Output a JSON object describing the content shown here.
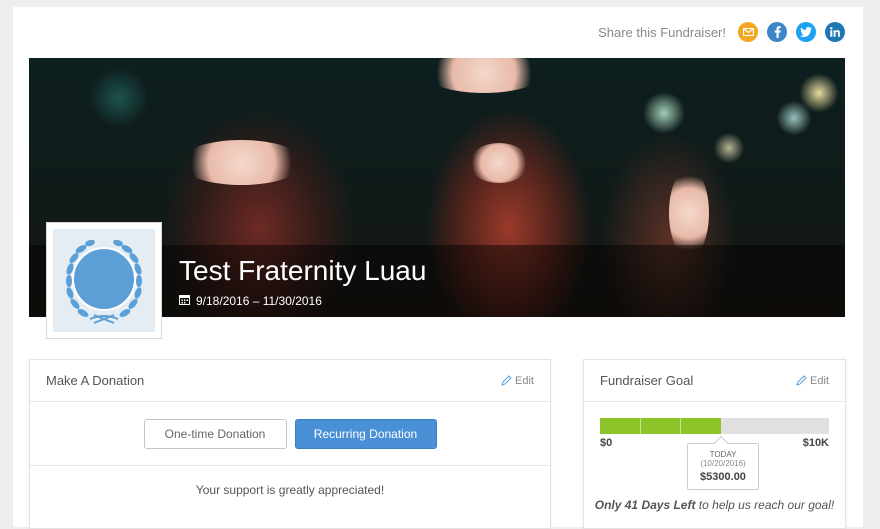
{
  "share": {
    "label": "Share this Fundraiser!",
    "icons": [
      "email-icon",
      "facebook-icon",
      "twitter-icon",
      "linkedin-icon"
    ],
    "colors": {
      "email": "#f5a623",
      "facebook": "#3b86c8",
      "twitter": "#1da1f2",
      "linkedin": "#1f78b4"
    }
  },
  "banner": {
    "title": "Test Fraternity Luau",
    "dates": "9/18/2016 – 11/30/2016"
  },
  "donation": {
    "title": "Make A Donation",
    "edit_label": "Edit",
    "one_time_label": "One-time Donation",
    "recurring_label": "Recurring Donation",
    "support_text": "Your support is greatly appreciated!"
  },
  "goal": {
    "title": "Fundraiser Goal",
    "edit_label": "Edit",
    "min_label": "$0",
    "max_label": "$10K",
    "progress_fraction": 0.53,
    "today_label": "TODAY",
    "today_date": "(10/20/2016)",
    "today_amount": "$5300.00",
    "days_left_bold": "Only 41 Days Left",
    "days_left_rest": " to help us reach our goal!"
  },
  "colors": {
    "accent": "#4a90d6",
    "progress": "#8cc42a"
  }
}
